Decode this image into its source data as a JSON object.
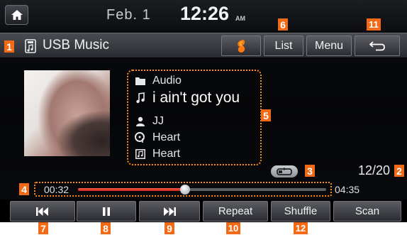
{
  "status_bar": {
    "date": "Feb.  1",
    "time": "12:26",
    "ampm": "AM"
  },
  "title_bar": {
    "source": "USB Music",
    "list_label": "List",
    "menu_label": "Menu"
  },
  "track": {
    "folder": "Audio",
    "title": "i ain't got you",
    "artist": "JJ",
    "album": "Heart",
    "genre": "Heart",
    "counter": "12/20"
  },
  "progress": {
    "elapsed": "00:32",
    "total": "04:35",
    "fraction": 0.43
  },
  "controls": {
    "repeat_label": "Repeat",
    "shuffle_label": "Shuffle",
    "scan_label": "Scan"
  },
  "callouts": {
    "c1": "1",
    "c2": "2",
    "c3": "3",
    "c4": "4",
    "c5": "5",
    "c6": "6",
    "c7": "7",
    "c8": "8",
    "c9": "9",
    "c10": "10",
    "c11": "11",
    "c12": "12"
  },
  "colors": {
    "accent": "#f26a16",
    "progress": "#e03a28",
    "background": "#07080a"
  }
}
